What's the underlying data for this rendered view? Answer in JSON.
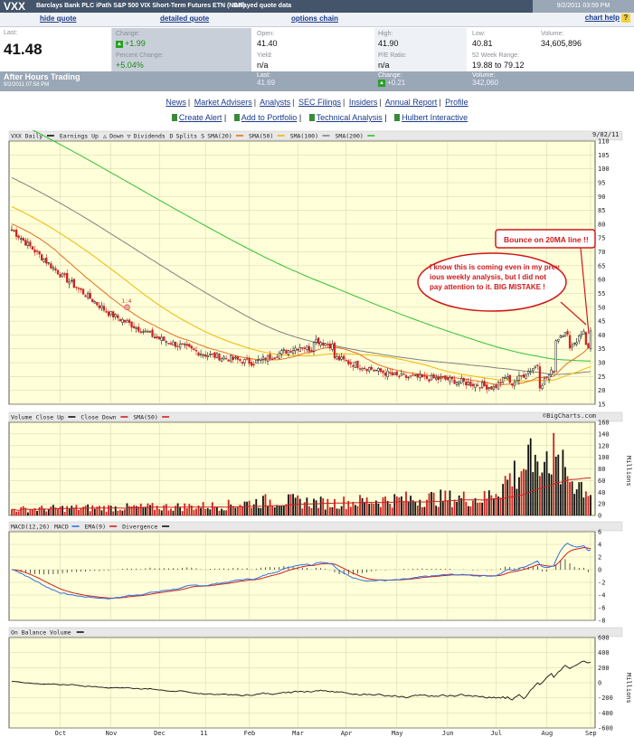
{
  "header": {
    "symbol": "VXX",
    "name": "Barclays Bank PLC iPath S&P 500 VIX Short-Term Futures ETN (NAR)",
    "delay_note": "Delayed quote data",
    "timestamp": "9/2/2011 03:59 PM",
    "links": {
      "hide_quote": "hide quote",
      "detailed_quote": "detailed quote",
      "options_chain": "options chain",
      "chart_help": "chart help",
      "help_glyph": "?"
    }
  },
  "quote": {
    "last_label": "Last:",
    "last_value": "41.48",
    "change_label": "Change:",
    "change_value": "+1.99",
    "pct_label": "Percent Change:",
    "pct_value": "+5.04%",
    "open_label": "Open:",
    "open_value": "41.40",
    "yield_label": "Yield:",
    "yield_value": "n/a",
    "high_label": "High:",
    "high_value": "41.90",
    "pe_label": "P/E Ratio:",
    "pe_value": "n/a",
    "low_label": "Low:",
    "low_value": "40.81",
    "range_label": "52 Week Range:",
    "range_value": "19.88 to 79.12",
    "volume_label": "Volume:",
    "volume_value": "34,605,896"
  },
  "after_hours": {
    "title": "After Hours Trading",
    "date": "9/2/2011 07:58 PM",
    "last_label": "Last:",
    "last_value": "41.69",
    "change_label": "Change:",
    "change_value": "+0.21",
    "volume_label": "Volume:",
    "volume_value": "342,060"
  },
  "nav": [
    "News",
    "Market Advisers",
    "Analysts",
    "SEC Filings",
    "Insiders",
    "Annual Report",
    "Profile"
  ],
  "tools": [
    "Create Alert",
    "Add to Portfolio",
    "Technical Analysis",
    "Hulbert Interactive"
  ],
  "colors": {
    "accent_dark": "#44546a",
    "plot_bg": "#ffffd9",
    "up": "#111111",
    "down": "#cc2222",
    "sma20": "#e07020",
    "sma50": "#f0b800",
    "sma100": "#808080",
    "sma200": "#30c030",
    "macd": "#3070e0",
    "ema9": "#cc2222"
  },
  "chart_data": [
    {
      "type": "candlestick",
      "title": "VXX Daily",
      "date_label": "9/02/11",
      "legend": [
        "Earnings Up",
        "Down",
        "Dividends",
        "Splits",
        "SMA(20)",
        "SMA(50)",
        "SMA(100)",
        "SMA(200)"
      ],
      "legend_glyphs": [
        "△",
        "▽",
        "D",
        "S"
      ],
      "split_label": "1:4",
      "y_ticks": [
        15,
        20,
        25,
        30,
        35,
        40,
        45,
        50,
        55,
        60,
        65,
        70,
        75,
        80,
        85,
        90,
        95,
        100,
        105,
        110
      ],
      "ylim": [
        15,
        110
      ],
      "x_ticks": [
        "Oct",
        "Nov",
        "Dec",
        "11",
        "Feb",
        "Mar",
        "Apr",
        "May",
        "Jun",
        "Jul",
        "Aug",
        "Sep"
      ],
      "approx_close_by_month": [
        {
          "month": "Sep-10",
          "close": 78
        },
        {
          "month": "Oct-10",
          "close": 62
        },
        {
          "month": "Nov-10",
          "close": 48
        },
        {
          "month": "Dec-10",
          "close": 39
        },
        {
          "month": "Jan-11",
          "close": 33
        },
        {
          "month": "Feb-11",
          "close": 30
        },
        {
          "month": "Mar-11",
          "close": 36
        },
        {
          "month": "Apr-11",
          "close": 30
        },
        {
          "month": "May-11",
          "close": 25
        },
        {
          "month": "Jun-11",
          "close": 24
        },
        {
          "month": "Jul-11",
          "close": 21
        },
        {
          "month": "Aug-11",
          "close": 36
        },
        {
          "month": "Sep-11",
          "close": 41
        }
      ],
      "annotations": [
        "Bounce on 20MA line !!",
        "I know this is coming even in my previous weekly analysis, but I did not pay attention to it. BIG MISTAKE !"
      ]
    },
    {
      "type": "bar",
      "title": "Volume",
      "legend": [
        "Close Up",
        "Close Down",
        "SMA(50)"
      ],
      "y_ticks": [
        0,
        20,
        40,
        60,
        80,
        100,
        120,
        140,
        160
      ],
      "ylim": [
        0,
        160
      ],
      "ylabel": "Millions",
      "source": "©BigCharts.com",
      "approx_volume_millions_by_month": [
        {
          "month": "Oct-10",
          "value": 10
        },
        {
          "month": "Nov-10",
          "value": 12
        },
        {
          "month": "Dec-10",
          "value": 13
        },
        {
          "month": "Jan-11",
          "value": 14
        },
        {
          "month": "Feb-11",
          "value": 16
        },
        {
          "month": "Mar-11",
          "value": 25
        },
        {
          "month": "Apr-11",
          "value": 20
        },
        {
          "month": "May-11",
          "value": 25
        },
        {
          "month": "Jun-11",
          "value": 28
        },
        {
          "month": "Jul-11",
          "value": 28
        },
        {
          "month": "Aug-11",
          "value": 100
        },
        {
          "month": "Sep-11",
          "value": 40
        }
      ]
    },
    {
      "type": "line",
      "title": "MACD(12,26)",
      "legend": [
        "MACD",
        "EMA(9)",
        "Divergence"
      ],
      "y_ticks": [
        -8,
        -6,
        -4,
        -2,
        0,
        2,
        4,
        6
      ],
      "ylim": [
        -8,
        6
      ]
    },
    {
      "type": "line",
      "title": "On Balance Volume",
      "y_ticks": [
        -600,
        -400,
        -200,
        0,
        200,
        400,
        600
      ],
      "ylim": [
        -600,
        600
      ],
      "ylabel": "Millions"
    }
  ]
}
